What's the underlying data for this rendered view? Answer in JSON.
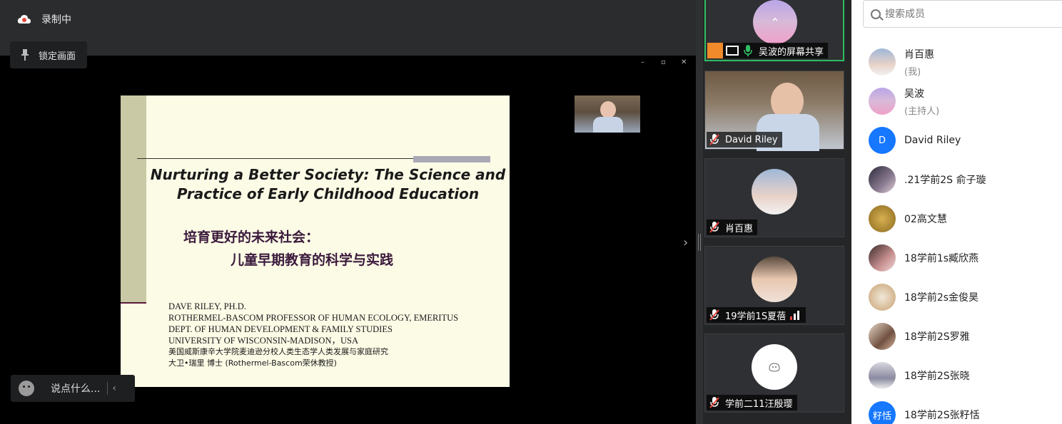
{
  "recording": {
    "label": "录制中"
  },
  "lock_button": {
    "label": "锁定画面"
  },
  "slide": {
    "title_line1": "Nurturing a Better Society: The Science and",
    "title_line2": "Practice of  Early Childhood Education",
    "cn_line1": "培育更好的未来社会：",
    "cn_line2": "儿童早期教育的科学与实践",
    "credit_1": "DAVE RILEY, PH.D.",
    "credit_2": "ROTHERMEL-BASCOM PROFESSOR OF HUMAN ECOLOGY, EMERITUS",
    "credit_3": "DEPT. OF HUMAN DEVELOPMENT & FAMILY STUDIES",
    "credit_4": "UNIVERSITY OF WISCONSIN-MADISON，USA",
    "credit_5": "美国威斯康辛大学院麦迪逊分校人类生态学人类发展与家庭研究",
    "credit_6": "大卫•瑞里 博士 (Rothermel-Bascom荣休教授)"
  },
  "chat": {
    "placeholder": "说点什么..."
  },
  "video_tiles": [
    {
      "name": "吴波的屏幕共享"
    },
    {
      "name": "David Riley"
    },
    {
      "name": "肖百惠"
    },
    {
      "name": "19学前1S夏蓓"
    },
    {
      "name": "学前二11汪殷璎"
    }
  ],
  "member_search": {
    "placeholder": "搜索成员"
  },
  "members": [
    {
      "name": "肖百惠",
      "role": "(我)"
    },
    {
      "name": "吴波",
      "role": "(主持人)"
    },
    {
      "name": "David Riley",
      "initial": "D",
      "color": "#1677ff"
    },
    {
      "name": ".21学前2S 俞子璇"
    },
    {
      "name": "02高文慧"
    },
    {
      "name": "18学前1s臧欣燕"
    },
    {
      "name": "18学前2s金俊昊"
    },
    {
      "name": "18学前2S罗雅"
    },
    {
      "name": "18学前2S张晓"
    },
    {
      "name": "18学前2S张籽恬",
      "initial": "籽恬",
      "color": "#1677ff"
    }
  ],
  "colors": {
    "active_border": "#2fbd62",
    "accent_blue": "#1677ff"
  }
}
